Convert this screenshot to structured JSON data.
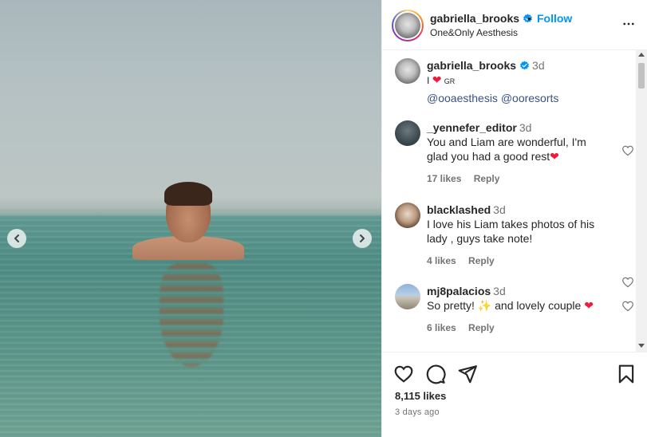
{
  "post": {
    "likes": "8,115 likes",
    "time_ago": "3 days ago"
  },
  "header": {
    "username": "gabriella_brooks",
    "follow_label": "Follow",
    "dot": "•",
    "location": "One&Only Aesthesis"
  },
  "caption": {
    "username": "gabriella_brooks",
    "time": "3d",
    "text_prefix": "I",
    "text_suffix": "GR",
    "mention1": "@ooaesthesis",
    "mention2": "@ooresorts"
  },
  "comments": [
    {
      "username": "_yennefer_editor",
      "time": "3d",
      "text": "You and Liam are wonderful, I'm glad you had a good rest",
      "likes": "17 likes",
      "reply": "Reply"
    },
    {
      "username": "blacklashed",
      "time": "3d",
      "text": "I love his Liam takes photos of his lady , guys take note!",
      "likes": "4 likes",
      "reply": "Reply"
    },
    {
      "username": "mj8palacios",
      "time": "3d",
      "text_prefix": "So pretty!",
      "text_suffix": "and lovely couple",
      "likes": "6 likes",
      "reply": "Reply"
    }
  ],
  "icons": {
    "verified": "verified-badge-icon",
    "heart": "heart-icon",
    "comment": "comment-icon",
    "share": "share-icon",
    "save": "bookmark-icon",
    "more": "more-icon"
  },
  "colors": {
    "accent": "#0095f6",
    "mention": "#385185",
    "heart_red": "#ed1c3b"
  }
}
